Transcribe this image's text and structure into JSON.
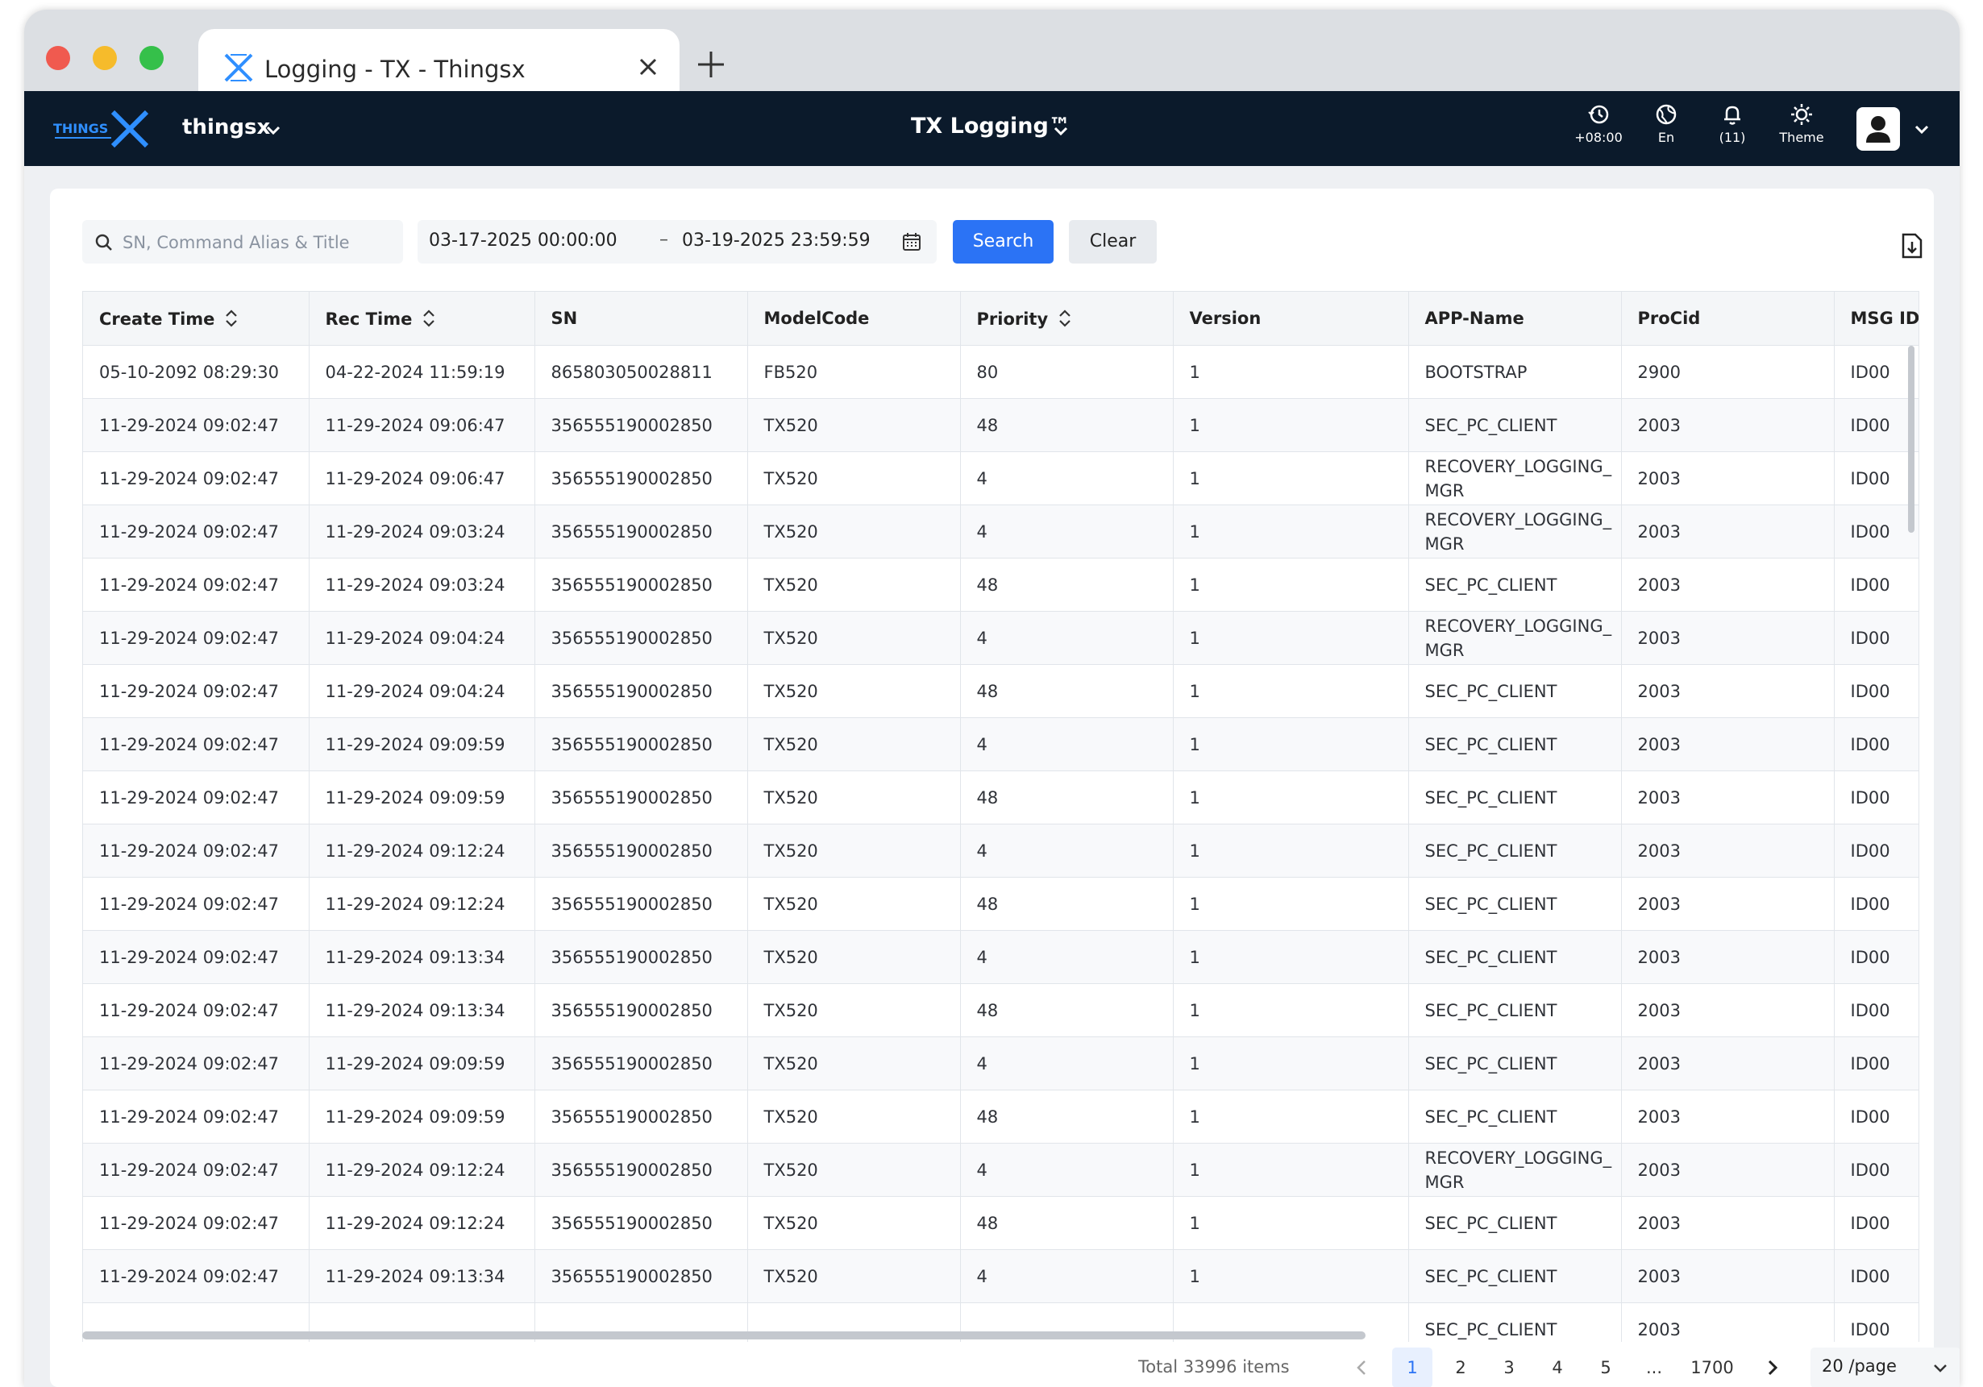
{
  "browser": {
    "tab_title": "Logging - TX - Thingsx"
  },
  "header": {
    "org": "thingsx",
    "app_title": "TX Logging™",
    "timezone": "+08:00",
    "language": "En",
    "notifications": "(11)",
    "theme": "Theme"
  },
  "filters": {
    "search_placeholder": "SN, Command Alias & Title",
    "date_start": "03-17-2025 00:00:00",
    "date_sep": "–",
    "date_end": "03-19-2025 23:59:59",
    "search_button": "Search",
    "clear_button": "Clear"
  },
  "table": {
    "columns": [
      "Create Time",
      "Rec Time",
      "SN",
      "ModelCode",
      "Priority",
      "Version",
      "APP-Name",
      "ProCid",
      "MSG ID"
    ],
    "rows": [
      [
        "05-10-2092 08:29:30",
        "04-22-2024 11:59:19",
        "865803050028811",
        "FB520",
        "80",
        "1",
        "BOOTSTRAP",
        "2900",
        "ID00"
      ],
      [
        "11-29-2024 09:02:47",
        "11-29-2024 09:06:47",
        "356555190002850",
        "TX520",
        "48",
        "1",
        "SEC_PC_CLIENT",
        "2003",
        "ID00"
      ],
      [
        "11-29-2024 09:02:47",
        "11-29-2024 09:06:47",
        "356555190002850",
        "TX520",
        "4",
        "1",
        "RECOVERY_LOGGING_MGR",
        "2003",
        "ID00"
      ],
      [
        "11-29-2024 09:02:47",
        "11-29-2024 09:03:24",
        "356555190002850",
        "TX520",
        "4",
        "1",
        "RECOVERY_LOGGING_MGR",
        "2003",
        "ID00"
      ],
      [
        "11-29-2024 09:02:47",
        "11-29-2024 09:03:24",
        "356555190002850",
        "TX520",
        "48",
        "1",
        "SEC_PC_CLIENT",
        "2003",
        "ID00"
      ],
      [
        "11-29-2024 09:02:47",
        "11-29-2024 09:04:24",
        "356555190002850",
        "TX520",
        "4",
        "1",
        "RECOVERY_LOGGING_MGR",
        "2003",
        "ID00"
      ],
      [
        "11-29-2024 09:02:47",
        "11-29-2024 09:04:24",
        "356555190002850",
        "TX520",
        "48",
        "1",
        "SEC_PC_CLIENT",
        "2003",
        "ID00"
      ],
      [
        "11-29-2024 09:02:47",
        "11-29-2024 09:09:59",
        "356555190002850",
        "TX520",
        "4",
        "1",
        "SEC_PC_CLIENT",
        "2003",
        "ID00"
      ],
      [
        "11-29-2024 09:02:47",
        "11-29-2024 09:09:59",
        "356555190002850",
        "TX520",
        "48",
        "1",
        "SEC_PC_CLIENT",
        "2003",
        "ID00"
      ],
      [
        "11-29-2024 09:02:47",
        "11-29-2024 09:12:24",
        "356555190002850",
        "TX520",
        "4",
        "1",
        "SEC_PC_CLIENT",
        "2003",
        "ID00"
      ],
      [
        "11-29-2024 09:02:47",
        "11-29-2024 09:12:24",
        "356555190002850",
        "TX520",
        "48",
        "1",
        "SEC_PC_CLIENT",
        "2003",
        "ID00"
      ],
      [
        "11-29-2024 09:02:47",
        "11-29-2024 09:13:34",
        "356555190002850",
        "TX520",
        "4",
        "1",
        "SEC_PC_CLIENT",
        "2003",
        "ID00"
      ],
      [
        "11-29-2024 09:02:47",
        "11-29-2024 09:13:34",
        "356555190002850",
        "TX520",
        "48",
        "1",
        "SEC_PC_CLIENT",
        "2003",
        "ID00"
      ],
      [
        "11-29-2024 09:02:47",
        "11-29-2024 09:09:59",
        "356555190002850",
        "TX520",
        "4",
        "1",
        "SEC_PC_CLIENT",
        "2003",
        "ID00"
      ],
      [
        "11-29-2024 09:02:47",
        "11-29-2024 09:09:59",
        "356555190002850",
        "TX520",
        "48",
        "1",
        "SEC_PC_CLIENT",
        "2003",
        "ID00"
      ],
      [
        "11-29-2024 09:02:47",
        "11-29-2024 09:12:24",
        "356555190002850",
        "TX520",
        "4",
        "1",
        "RECOVERY_LOGGING_MGR",
        "2003",
        "ID00"
      ],
      [
        "11-29-2024 09:02:47",
        "11-29-2024 09:12:24",
        "356555190002850",
        "TX520",
        "48",
        "1",
        "SEC_PC_CLIENT",
        "2003",
        "ID00"
      ],
      [
        "11-29-2024 09:02:47",
        "11-29-2024 09:13:34",
        "356555190002850",
        "TX520",
        "4",
        "1",
        "SEC_PC_CLIENT",
        "2003",
        "ID00"
      ],
      [
        "",
        "",
        "",
        "",
        "",
        "",
        "SEC_PC_CLIENT",
        "2003",
        "ID00"
      ]
    ]
  },
  "pagination": {
    "total": "Total 33996 items",
    "pages": [
      "1",
      "2",
      "3",
      "4",
      "5",
      "...",
      "1700"
    ],
    "active_page": "1",
    "page_size": "20 /page"
  },
  "colors": {
    "header_bg": "#0b1a2b",
    "accent": "#2b73f5",
    "brand": "#2f8fff"
  },
  "icons": [
    "thingsx-logo",
    "close-icon",
    "plus-icon",
    "chevron-down-icon",
    "history-clock-icon",
    "globe-icon",
    "bell-icon",
    "sun-icon",
    "user-icon",
    "search-icon",
    "calendar-icon",
    "sort-icon",
    "export-icon",
    "chevron-left-icon",
    "chevron-right-icon"
  ]
}
